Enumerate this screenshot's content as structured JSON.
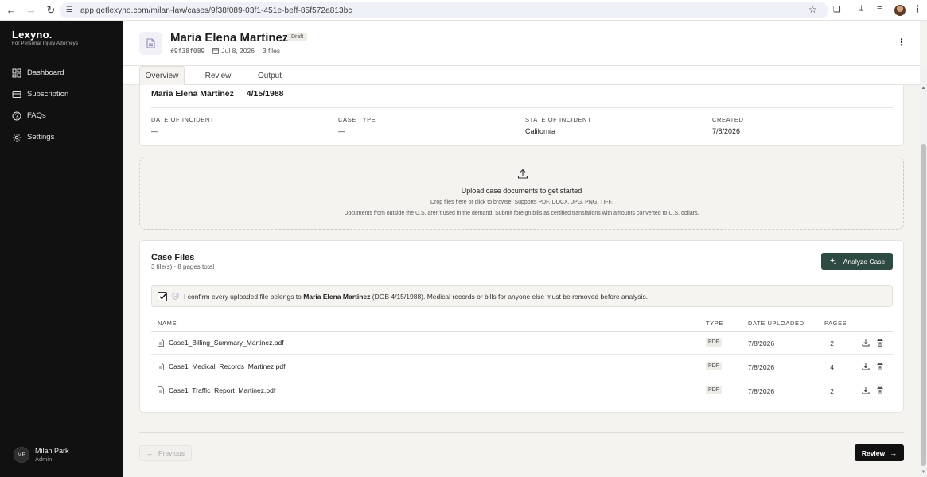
{
  "browser": {
    "url": "app.getlexyno.com/milan-law/cases/9f38f089-03f1-451e-beff-85f572a813bc"
  },
  "sidebar": {
    "brand_name": "Lexyno.",
    "brand_tagline": "For Personal Injury Attorneys",
    "items": [
      {
        "label": "Dashboard",
        "icon": "dashboard-icon"
      },
      {
        "label": "Subscription",
        "icon": "card-icon"
      },
      {
        "label": "FAQs",
        "icon": "help-icon"
      },
      {
        "label": "Settings",
        "icon": "gear-icon"
      }
    ],
    "user": {
      "initials": "MP",
      "name": "Milan Park",
      "role": "Admin"
    }
  },
  "header": {
    "title": "Maria Elena Martinez",
    "badge": "Draft",
    "case_id": "#9f38f089",
    "date": "Jul 8, 2026",
    "files_count": "3 files"
  },
  "tabs": [
    {
      "label": "Overview",
      "active": true
    },
    {
      "label": "Review",
      "active": false
    },
    {
      "label": "Output",
      "active": false
    }
  ],
  "client": {
    "name": "Maria Elena Martinez",
    "dob": "4/15/1988",
    "fields": [
      {
        "label": "DATE OF INCIDENT",
        "value": "—"
      },
      {
        "label": "CASE TYPE",
        "value": "—"
      },
      {
        "label": "STATE OF INCIDENT",
        "value": "California"
      },
      {
        "label": "CREATED",
        "value": "7/8/2026"
      }
    ]
  },
  "upload": {
    "title": "Upload case documents to get started",
    "subtitle": "Drop files here or click to browse. Supports PDF, DOCX, JPG, PNG, TIFF.",
    "note": "Documents from outside the U.S. aren't used in the demand. Submit foreign bills as certified translations with amounts converted to U.S. dollars."
  },
  "case_files": {
    "title": "Case Files",
    "summary": "3 file(s) · 8 pages total",
    "analyze_label": "Analyze Case",
    "confirm": {
      "checked": true,
      "prefix": "I confirm every uploaded file belongs to",
      "name": "Maria Elena Martinez",
      "suffix": "(DOB 4/15/1988). Medical records or bills for anyone else must be removed before analysis."
    },
    "columns": [
      "NAME",
      "TYPE",
      "DATE UPLOADED",
      "PAGES"
    ],
    "files": [
      {
        "name": "Case1_Billing_Summary_Martinez.pdf",
        "type": "PDF",
        "date": "7/8/2026",
        "pages": "2"
      },
      {
        "name": "Case1_Medical_Records_Martinez.pdf",
        "type": "PDF",
        "date": "7/8/2026",
        "pages": "4"
      },
      {
        "name": "Case1_Traffic_Report_Martinez.pdf",
        "type": "PDF",
        "date": "7/8/2026",
        "pages": "2"
      }
    ]
  },
  "footer": {
    "previous_label": "Previous",
    "review_label": "Review"
  },
  "colors": {
    "sidebar_bg": "#111111",
    "analyze_button": "#2d4b42",
    "page_bg": "#f4f3ef"
  }
}
